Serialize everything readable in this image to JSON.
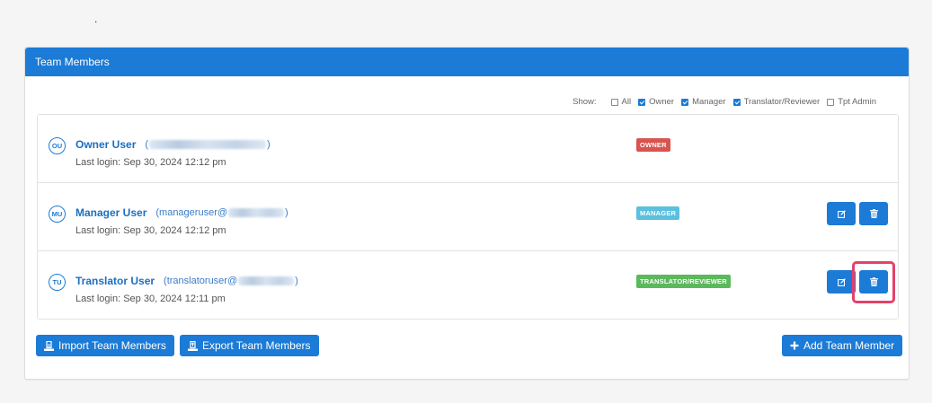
{
  "panel": {
    "title": "Team Members"
  },
  "filters": {
    "show_label": "Show:",
    "options": [
      {
        "label": "All",
        "checked": false
      },
      {
        "label": "Owner",
        "checked": true
      },
      {
        "label": "Manager",
        "checked": true
      },
      {
        "label": "Translator/Reviewer",
        "checked": true
      },
      {
        "label": "Tpt Admin",
        "checked": false
      }
    ]
  },
  "members": [
    {
      "initials": "OU",
      "name": "Owner User",
      "email_open": "(",
      "email_close": ")",
      "last_login": "Last login: Sep 30, 2024 12:12 pm",
      "badge": "OWNER",
      "badge_color": "#d9534f"
    },
    {
      "initials": "MU",
      "name": "Manager User",
      "email_open": "(manageruser@",
      "email_close": ")",
      "last_login": "Last login: Sep 30, 2024 12:12 pm",
      "badge": "MANAGER",
      "badge_color": "#5bc0de"
    },
    {
      "initials": "TU",
      "name": "Translator User",
      "email_open": "(translatoruser@",
      "email_close": ")",
      "last_login": "Last login: Sep 30, 2024 12:11 pm",
      "badge": "TRANSLATOR/REVIEWER",
      "badge_color": "#5cb85c"
    }
  ],
  "buttons": {
    "import": "Import Team Members",
    "export": "Export Team Members",
    "add": "Add Team Member"
  },
  "colors": {
    "primary": "#1b7bd6",
    "highlight": "#e4416a"
  },
  "icons": {
    "edit": "edit-icon",
    "delete": "trash-icon",
    "import": "import-icon",
    "export": "export-icon",
    "add": "plus-icon"
  }
}
